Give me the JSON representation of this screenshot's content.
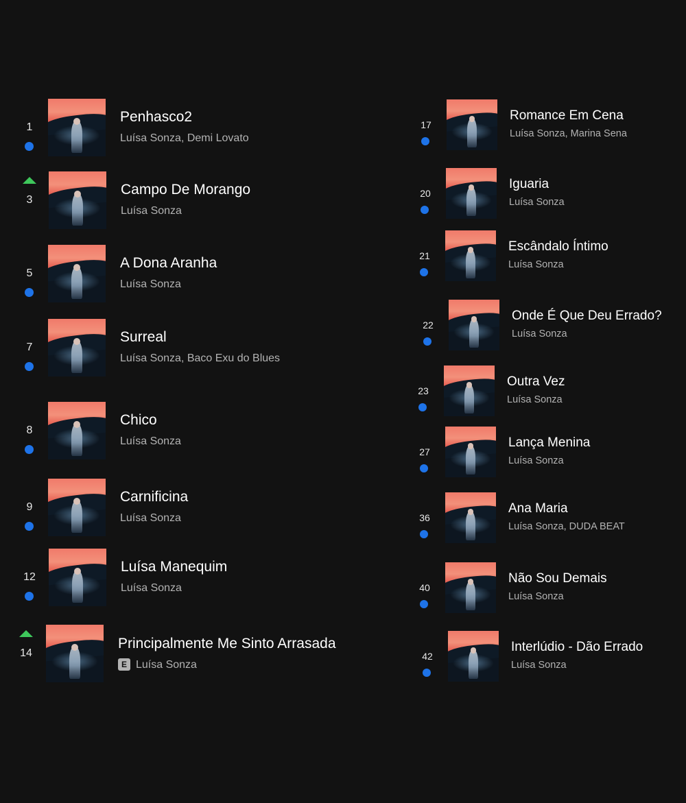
{
  "left_tracks": [
    {
      "rank": "1",
      "movement": "new",
      "title": "Penhasco2",
      "artist": "Luísa Sonza, Demi Lovato",
      "explicit": false
    },
    {
      "rank": "3",
      "movement": "up",
      "title": "Campo De Morango",
      "artist": "Luísa Sonza",
      "explicit": false
    },
    {
      "rank": "5",
      "movement": "new",
      "title": "A Dona Aranha",
      "artist": "Luísa Sonza",
      "explicit": false
    },
    {
      "rank": "7",
      "movement": "new",
      "title": "Surreal",
      "artist": "Luísa Sonza, Baco Exu do Blues",
      "explicit": false
    },
    {
      "rank": "8",
      "movement": "new",
      "title": "Chico",
      "artist": "Luísa Sonza",
      "explicit": false
    },
    {
      "rank": "9",
      "movement": "new",
      "title": "Carnificina",
      "artist": "Luísa Sonza",
      "explicit": false
    },
    {
      "rank": "12",
      "movement": "new",
      "title": "Luísa Manequim",
      "artist": "Luísa Sonza",
      "explicit": false
    },
    {
      "rank": "14",
      "movement": "up",
      "title": "Principalmente Me Sinto Arrasada",
      "artist": "Luísa Sonza",
      "explicit": true,
      "explicit_label": "E"
    }
  ],
  "right_tracks": [
    {
      "rank": "17",
      "movement": "new",
      "title": "Romance Em Cena",
      "artist": "Luísa Sonza, Marina Sena"
    },
    {
      "rank": "20",
      "movement": "new",
      "title": "Iguaria",
      "artist": "Luísa Sonza"
    },
    {
      "rank": "21",
      "movement": "new",
      "title": "Escândalo Íntimo",
      "artist": "Luísa Sonza"
    },
    {
      "rank": "22",
      "movement": "new",
      "title": "Onde É Que Deu Errado?",
      "artist": "Luísa Sonza"
    },
    {
      "rank": "23",
      "movement": "new",
      "title": "Outra Vez",
      "artist": "Luísa Sonza"
    },
    {
      "rank": "27",
      "movement": "new",
      "title": "Lança Menina",
      "artist": "Luísa Sonza"
    },
    {
      "rank": "36",
      "movement": "new",
      "title": "Ana Maria",
      "artist": "Luísa Sonza, DUDA BEAT"
    },
    {
      "rank": "40",
      "movement": "new",
      "title": "Não Sou Demais",
      "artist": "Luísa Sonza"
    },
    {
      "rank": "42",
      "movement": "new",
      "title": "Interlúdio - Dão Errado",
      "artist": "Luísa Sonza"
    }
  ],
  "colors": {
    "background": "#121212",
    "new_dot": "#1e73e8",
    "up_arrow": "#3ec75b",
    "artist_text": "#b3b3b3"
  },
  "icons": {
    "new": "blue-dot-icon",
    "up": "green-up-arrow-icon",
    "explicit": "explicit-badge-icon"
  }
}
